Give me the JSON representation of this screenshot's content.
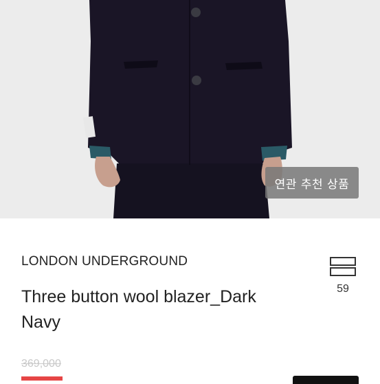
{
  "related_button": {
    "label": "연관 추천 상품"
  },
  "product": {
    "brand": "LONDON UNDERGROUND",
    "title": "Three button wool blazer_Dark Navy",
    "wish_count": "59",
    "original_price": "369,000"
  },
  "colors": {
    "blazer": "#1a1526",
    "background": "#ececec",
    "sale": "#e64545"
  }
}
